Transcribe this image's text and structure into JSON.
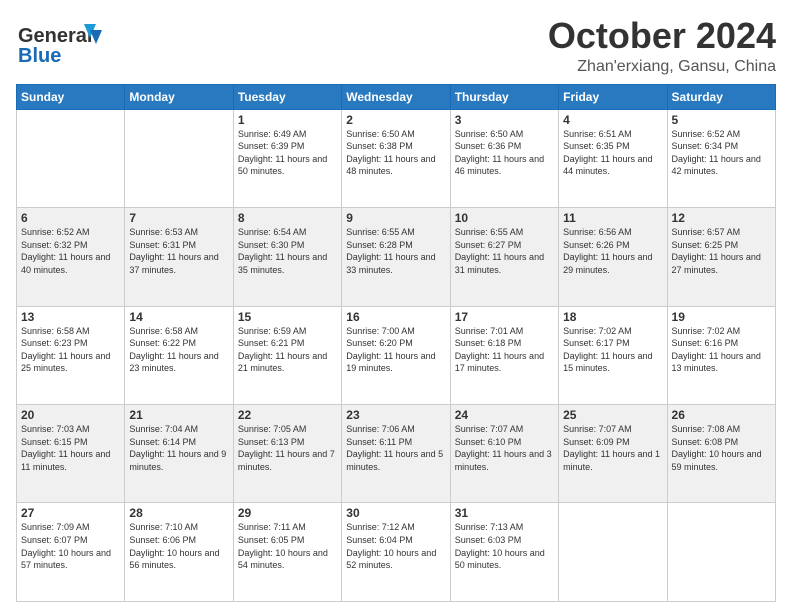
{
  "header": {
    "logo_general": "General",
    "logo_blue": "Blue",
    "month_title": "October 2024",
    "location": "Zhan'erxiang, Gansu, China"
  },
  "days_of_week": [
    "Sunday",
    "Monday",
    "Tuesday",
    "Wednesday",
    "Thursday",
    "Friday",
    "Saturday"
  ],
  "weeks": [
    [
      {
        "day": "",
        "info": ""
      },
      {
        "day": "",
        "info": ""
      },
      {
        "day": "1",
        "info": "Sunrise: 6:49 AM\nSunset: 6:39 PM\nDaylight: 11 hours and 50 minutes."
      },
      {
        "day": "2",
        "info": "Sunrise: 6:50 AM\nSunset: 6:38 PM\nDaylight: 11 hours and 48 minutes."
      },
      {
        "day": "3",
        "info": "Sunrise: 6:50 AM\nSunset: 6:36 PM\nDaylight: 11 hours and 46 minutes."
      },
      {
        "day": "4",
        "info": "Sunrise: 6:51 AM\nSunset: 6:35 PM\nDaylight: 11 hours and 44 minutes."
      },
      {
        "day": "5",
        "info": "Sunrise: 6:52 AM\nSunset: 6:34 PM\nDaylight: 11 hours and 42 minutes."
      }
    ],
    [
      {
        "day": "6",
        "info": "Sunrise: 6:52 AM\nSunset: 6:32 PM\nDaylight: 11 hours and 40 minutes."
      },
      {
        "day": "7",
        "info": "Sunrise: 6:53 AM\nSunset: 6:31 PM\nDaylight: 11 hours and 37 minutes."
      },
      {
        "day": "8",
        "info": "Sunrise: 6:54 AM\nSunset: 6:30 PM\nDaylight: 11 hours and 35 minutes."
      },
      {
        "day": "9",
        "info": "Sunrise: 6:55 AM\nSunset: 6:28 PM\nDaylight: 11 hours and 33 minutes."
      },
      {
        "day": "10",
        "info": "Sunrise: 6:55 AM\nSunset: 6:27 PM\nDaylight: 11 hours and 31 minutes."
      },
      {
        "day": "11",
        "info": "Sunrise: 6:56 AM\nSunset: 6:26 PM\nDaylight: 11 hours and 29 minutes."
      },
      {
        "day": "12",
        "info": "Sunrise: 6:57 AM\nSunset: 6:25 PM\nDaylight: 11 hours and 27 minutes."
      }
    ],
    [
      {
        "day": "13",
        "info": "Sunrise: 6:58 AM\nSunset: 6:23 PM\nDaylight: 11 hours and 25 minutes."
      },
      {
        "day": "14",
        "info": "Sunrise: 6:58 AM\nSunset: 6:22 PM\nDaylight: 11 hours and 23 minutes."
      },
      {
        "day": "15",
        "info": "Sunrise: 6:59 AM\nSunset: 6:21 PM\nDaylight: 11 hours and 21 minutes."
      },
      {
        "day": "16",
        "info": "Sunrise: 7:00 AM\nSunset: 6:20 PM\nDaylight: 11 hours and 19 minutes."
      },
      {
        "day": "17",
        "info": "Sunrise: 7:01 AM\nSunset: 6:18 PM\nDaylight: 11 hours and 17 minutes."
      },
      {
        "day": "18",
        "info": "Sunrise: 7:02 AM\nSunset: 6:17 PM\nDaylight: 11 hours and 15 minutes."
      },
      {
        "day": "19",
        "info": "Sunrise: 7:02 AM\nSunset: 6:16 PM\nDaylight: 11 hours and 13 minutes."
      }
    ],
    [
      {
        "day": "20",
        "info": "Sunrise: 7:03 AM\nSunset: 6:15 PM\nDaylight: 11 hours and 11 minutes."
      },
      {
        "day": "21",
        "info": "Sunrise: 7:04 AM\nSunset: 6:14 PM\nDaylight: 11 hours and 9 minutes."
      },
      {
        "day": "22",
        "info": "Sunrise: 7:05 AM\nSunset: 6:13 PM\nDaylight: 11 hours and 7 minutes."
      },
      {
        "day": "23",
        "info": "Sunrise: 7:06 AM\nSunset: 6:11 PM\nDaylight: 11 hours and 5 minutes."
      },
      {
        "day": "24",
        "info": "Sunrise: 7:07 AM\nSunset: 6:10 PM\nDaylight: 11 hours and 3 minutes."
      },
      {
        "day": "25",
        "info": "Sunrise: 7:07 AM\nSunset: 6:09 PM\nDaylight: 11 hours and 1 minute."
      },
      {
        "day": "26",
        "info": "Sunrise: 7:08 AM\nSunset: 6:08 PM\nDaylight: 10 hours and 59 minutes."
      }
    ],
    [
      {
        "day": "27",
        "info": "Sunrise: 7:09 AM\nSunset: 6:07 PM\nDaylight: 10 hours and 57 minutes."
      },
      {
        "day": "28",
        "info": "Sunrise: 7:10 AM\nSunset: 6:06 PM\nDaylight: 10 hours and 56 minutes."
      },
      {
        "day": "29",
        "info": "Sunrise: 7:11 AM\nSunset: 6:05 PM\nDaylight: 10 hours and 54 minutes."
      },
      {
        "day": "30",
        "info": "Sunrise: 7:12 AM\nSunset: 6:04 PM\nDaylight: 10 hours and 52 minutes."
      },
      {
        "day": "31",
        "info": "Sunrise: 7:13 AM\nSunset: 6:03 PM\nDaylight: 10 hours and 50 minutes."
      },
      {
        "day": "",
        "info": ""
      },
      {
        "day": "",
        "info": ""
      }
    ]
  ]
}
